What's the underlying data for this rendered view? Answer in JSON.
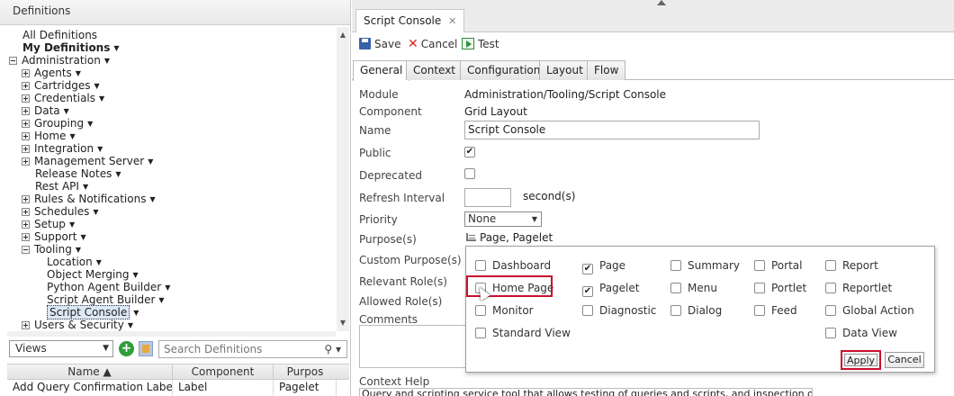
{
  "left": {
    "header": "Definitions",
    "tree": [
      {
        "label": "All Definitions",
        "bold": false,
        "caret": false,
        "exp": "",
        "indent": 0
      },
      {
        "label": "My Definitions",
        "bold": true,
        "caret": true,
        "exp": "",
        "indent": 0
      },
      {
        "label": "Administration",
        "bold": false,
        "caret": true,
        "exp": "minus",
        "indent": -1
      },
      {
        "label": "Agents",
        "bold": false,
        "caret": true,
        "exp": "plus",
        "indent": 1
      },
      {
        "label": "Cartridges",
        "bold": false,
        "caret": true,
        "exp": "plus",
        "indent": 1
      },
      {
        "label": "Credentials",
        "bold": false,
        "caret": true,
        "exp": "plus",
        "indent": 1
      },
      {
        "label": "Data",
        "bold": false,
        "caret": true,
        "exp": "plus",
        "indent": 1
      },
      {
        "label": "Grouping",
        "bold": false,
        "caret": true,
        "exp": "plus",
        "indent": 1
      },
      {
        "label": "Home",
        "bold": false,
        "caret": true,
        "exp": "plus",
        "indent": 1
      },
      {
        "label": "Integration",
        "bold": false,
        "caret": true,
        "exp": "plus",
        "indent": 1
      },
      {
        "label": "Management Server",
        "bold": false,
        "caret": true,
        "exp": "plus",
        "indent": 1
      },
      {
        "label": "Release Notes",
        "bold": false,
        "caret": true,
        "exp": "",
        "indent": 2
      },
      {
        "label": "Rest API",
        "bold": false,
        "caret": true,
        "exp": "",
        "indent": 2
      },
      {
        "label": "Rules & Notifications",
        "bold": false,
        "caret": true,
        "exp": "plus",
        "indent": 1
      },
      {
        "label": "Schedules",
        "bold": false,
        "caret": true,
        "exp": "plus",
        "indent": 1
      },
      {
        "label": "Setup",
        "bold": false,
        "caret": true,
        "exp": "plus",
        "indent": 1
      },
      {
        "label": "Support",
        "bold": false,
        "caret": true,
        "exp": "plus",
        "indent": 1
      },
      {
        "label": "Tooling",
        "bold": false,
        "caret": true,
        "exp": "minus",
        "indent": 1
      },
      {
        "label": "Location",
        "bold": false,
        "caret": true,
        "exp": "",
        "indent": 3
      },
      {
        "label": "Object Merging",
        "bold": false,
        "caret": true,
        "exp": "",
        "indent": 3
      },
      {
        "label": "Python Agent Builder",
        "bold": false,
        "caret": true,
        "exp": "",
        "indent": 3
      },
      {
        "label": "Script Agent Builder",
        "bold": false,
        "caret": true,
        "exp": "",
        "indent": 3
      },
      {
        "label": "Script Console",
        "bold": false,
        "caret": true,
        "exp": "",
        "indent": 3,
        "selected": true
      },
      {
        "label": "Users & Security",
        "bold": false,
        "caret": true,
        "exp": "plus",
        "indent": 1
      }
    ],
    "views_label": "Views",
    "search_placeholder": "Search Definitions",
    "grid": {
      "headers": [
        "Name ▲",
        "Component",
        "Purpos"
      ],
      "row": [
        "Add Query Confirmation Label",
        "Label",
        "Pagelet"
      ]
    }
  },
  "right": {
    "tab_label": "Script Console",
    "tab_close": "✕",
    "toolbar": {
      "save": "Save",
      "cancel": "Cancel",
      "test": "Test"
    },
    "subtabs": [
      "General",
      "Context",
      "Configuration",
      "Layout",
      "Flow"
    ],
    "fields": {
      "module_label": "Module",
      "module_value": "Administration/Tooling/Script Console",
      "component_label": "Component",
      "component_value": "Grid Layout",
      "name_label": "Name",
      "name_value": "Script Console",
      "public_label": "Public",
      "public_checked": true,
      "deprecated_label": "Deprecated",
      "deprecated_checked": false,
      "refresh_label": "Refresh Interval",
      "refresh_unit": "second(s)",
      "priority_label": "Priority",
      "priority_value": "None",
      "purposes_label": "Purpose(s)",
      "purposes_value": "Page, Pagelet",
      "custom_purpose_label": "Custom Purpose(s)",
      "relevant_role_label": "Relevant Role(s)",
      "allowed_role_label": "Allowed Role(s)",
      "comments_label": "Comments",
      "context_help_label": "Context Help",
      "context_help_value": "Query and scripting service tool that allows testing of queries and scripts, and inspection of"
    },
    "popup": {
      "options": [
        {
          "label": "Dashboard",
          "checked": false
        },
        {
          "label": "Page",
          "checked": true
        },
        {
          "label": "Summary",
          "checked": false
        },
        {
          "label": "Portal",
          "checked": false
        },
        {
          "label": "Report",
          "checked": false
        },
        {
          "label": "Home Page",
          "checked": false
        },
        {
          "label": "Pagelet",
          "checked": true
        },
        {
          "label": "Menu",
          "checked": false
        },
        {
          "label": "Portlet",
          "checked": false
        },
        {
          "label": "Reportlet",
          "checked": false
        },
        {
          "label": "Monitor",
          "checked": false
        },
        {
          "label": "Diagnostic",
          "checked": false
        },
        {
          "label": "Dialog",
          "checked": false
        },
        {
          "label": "Feed",
          "checked": false
        },
        {
          "label": "Global Action",
          "checked": false
        },
        {
          "label": "Standard View",
          "checked": false
        },
        {
          "label": "Data View",
          "checked": false
        }
      ],
      "apply": "Apply",
      "cancel": "Cancel"
    }
  },
  "colors": {
    "highlight": "#c8102e",
    "selection": "#dde8f5"
  }
}
